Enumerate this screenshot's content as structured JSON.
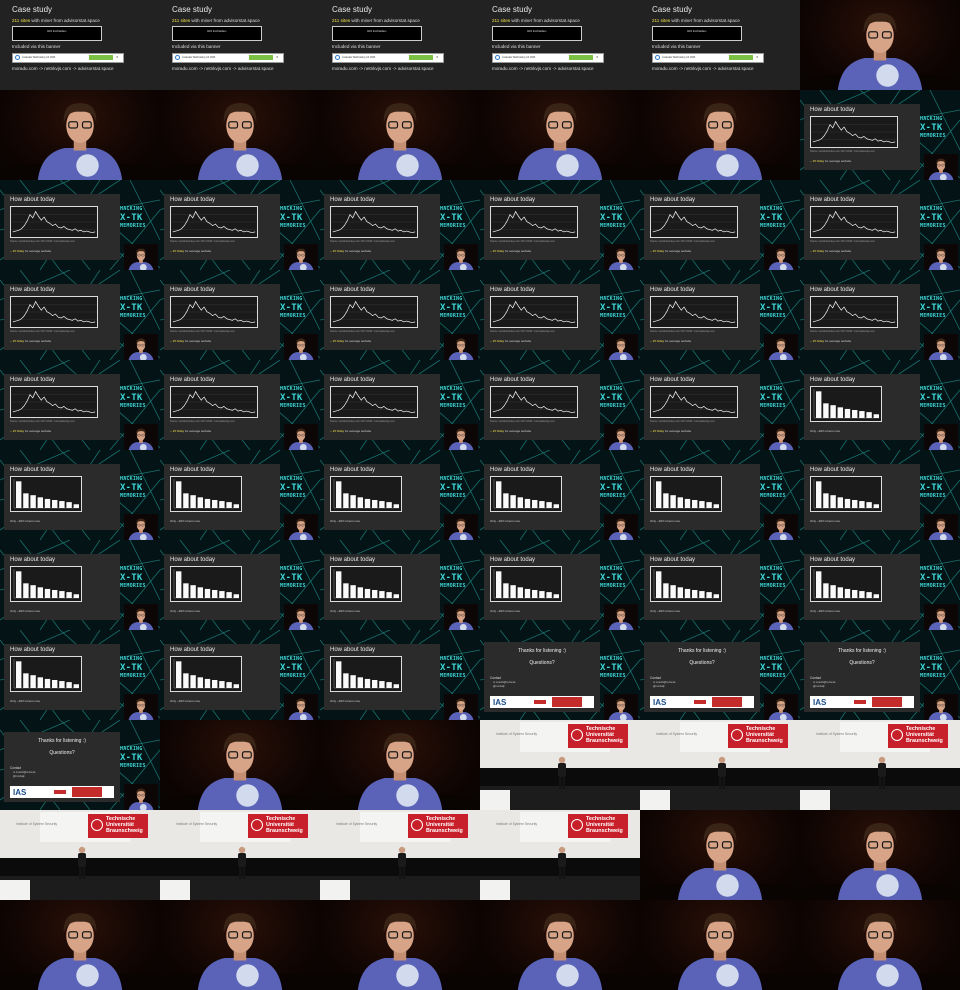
{
  "case_study": {
    "title": "Case study",
    "line1_count": "211 sites",
    "line1_rest": " with miner from advisorstat.space",
    "box_text": "403 Forbidden.",
    "line2": "Included via this banner",
    "banner_text": "moderate Webhosting mit CMS",
    "line3": "moradu.com -> netnkvjs.com -> advisorstat.space"
  },
  "slide_title": "How about today",
  "line_caption_prefix": "~ 15 h/day",
  "line_caption_rest": " for average website",
  "bar_caption": "Only ~400 miners now",
  "source_text": "Source: worldcoinindex.com 2017-2018 / coinmarketcap.com",
  "backdrop_logo": {
    "line1": "HACKING",
    "line2": "X-TK",
    "line3": "MEMORIES"
  },
  "thanks": {
    "title": "Thanks for listening :)",
    "question": "Questions?",
    "contact_label": "Contact",
    "contact_1": "m.musch@tu-bs.de",
    "contact_2": "@mmlsqk",
    "logo_text": "IAS"
  },
  "stage_banner": {
    "university": "Technische Universität Braunschweig",
    "institute": "Institute of System Security"
  },
  "chart_data": [
    {
      "type": "line",
      "title": "How about today",
      "x": [
        0,
        1,
        2,
        3,
        4,
        5,
        6,
        7,
        8,
        9,
        10,
        11,
        12,
        13,
        14,
        15,
        16,
        17,
        18,
        19,
        20,
        21,
        22,
        23,
        24,
        25,
        26,
        27,
        28,
        29
      ],
      "values": [
        4,
        5,
        6,
        8,
        12,
        18,
        26,
        22,
        30,
        24,
        19,
        23,
        17,
        15,
        12,
        14,
        10,
        9,
        11,
        8,
        7,
        6,
        8,
        5,
        6,
        4,
        5,
        4,
        3,
        4
      ]
    },
    {
      "type": "bar",
      "title": "How about today",
      "values": [
        100,
        55,
        48,
        40,
        34,
        30,
        26,
        22,
        14
      ]
    }
  ],
  "grid_layout": [
    "case",
    "case",
    "case",
    "case",
    "case",
    "spk",
    "spk",
    "spk",
    "spk",
    "spk",
    "spk",
    "line",
    "line",
    "line",
    "line",
    "line",
    "line",
    "line",
    "line",
    "line",
    "line",
    "line",
    "line",
    "line",
    "line",
    "line",
    "line",
    "line",
    "line",
    "bar",
    "bar",
    "bar",
    "bar",
    "bar",
    "bar",
    "bar",
    "bar",
    "bar",
    "bar",
    "bar",
    "bar",
    "bar",
    "bar",
    "bar",
    "bar",
    "thanks",
    "thanks",
    "thanks",
    "thanks",
    "spk",
    "spk",
    "stage",
    "stage",
    "stage",
    "stage",
    "stage",
    "stage",
    "stage",
    "spk",
    "spk",
    "spk",
    "spk",
    "spk",
    "spk",
    "spk",
    "spk"
  ]
}
